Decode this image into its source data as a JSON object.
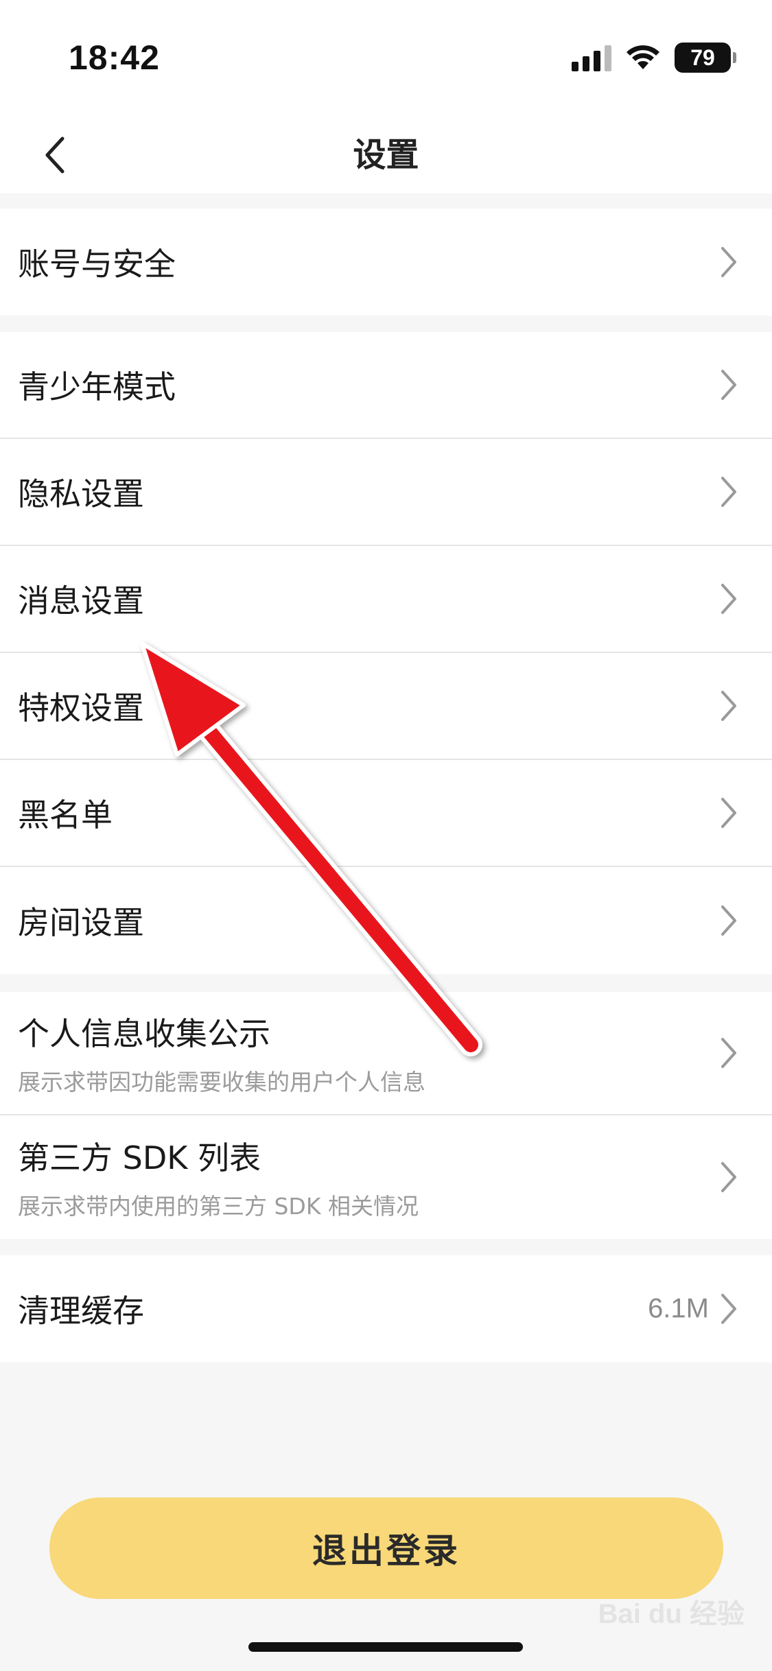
{
  "status_bar": {
    "time": "18:42",
    "battery": "79"
  },
  "nav": {
    "title": "设置"
  },
  "group1": [
    {
      "label": "账号与安全"
    }
  ],
  "group2": [
    {
      "label": "青少年模式"
    },
    {
      "label": "隐私设置"
    },
    {
      "label": "消息设置"
    },
    {
      "label": "特权设置"
    },
    {
      "label": "黑名单"
    },
    {
      "label": "房间设置"
    }
  ],
  "group3": [
    {
      "label": "个人信息收集公示",
      "sub": "展示求带因功能需要收集的用户个人信息"
    },
    {
      "label": "第三方 SDK 列表",
      "sub": "展示求带内使用的第三方 SDK 相关情况"
    }
  ],
  "group4": [
    {
      "label": "清理缓存",
      "value": "6.1M"
    }
  ],
  "logout_label": "退出登录",
  "watermark": "Bai du 经验",
  "colors": {
    "accent": "#f8d878",
    "annotation": "#e8141c"
  },
  "icons": {
    "back": "chevron-left-icon",
    "row_arrow": "chevron-right-icon"
  }
}
